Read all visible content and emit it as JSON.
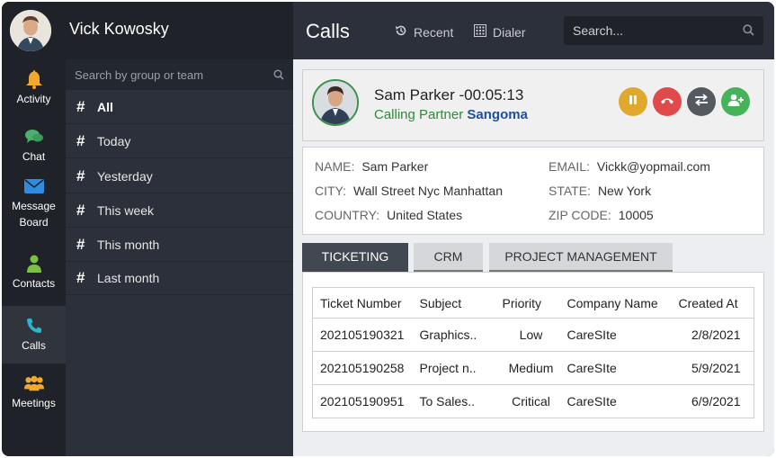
{
  "user": {
    "name": "Vick Kowosky"
  },
  "rail": [
    {
      "label": "Activity",
      "icon": "bell-icon",
      "color": "#f0a92a"
    },
    {
      "label": "Chat",
      "icon": "chat-icon",
      "color": "#4caf6d"
    },
    {
      "label": "Message Board",
      "icon": "envelope-icon",
      "color": "#2e8de0"
    },
    {
      "label": "Contacts",
      "icon": "person-icon",
      "color": "#7ac043"
    },
    {
      "label": "Calls",
      "icon": "phone-icon",
      "color": "#2bb5d1"
    },
    {
      "label": "Meetings",
      "icon": "group-icon",
      "color": "#f0a92a"
    }
  ],
  "groups": {
    "search_placeholder": "Search by group or team",
    "items": [
      "All",
      "Today",
      "Yesterday",
      "This week",
      "This month",
      "Last month"
    ]
  },
  "topbar": {
    "title": "Calls",
    "recent_label": "Recent",
    "dialer_label": "Dialer",
    "search_placeholder": "Search..."
  },
  "call": {
    "name": "Sam Parker",
    "timer": "-00:05:13",
    "calling_label": "Calling Partner",
    "partner": "Sangoma",
    "buttons": [
      {
        "name": "pause-icon",
        "color": "#e0a92e"
      },
      {
        "name": "hangup-icon",
        "color": "#e04a4a"
      },
      {
        "name": "transfer-icon",
        "color": "#555a60"
      },
      {
        "name": "add-user-icon",
        "color": "#45b35a"
      }
    ]
  },
  "contact": {
    "name_label": "NAME:",
    "name": "Sam Parker",
    "email_label": "EMAIL:",
    "email": "Vickk@yopmail.com",
    "city_label": "CITY:",
    "city": "Wall Street Nyc Manhattan",
    "state_label": "STATE:",
    "state": "New York",
    "country_label": "COUNTRY:",
    "country": "United States",
    "zip_label": "ZIP CODE:",
    "zip": "10005"
  },
  "tabs": [
    "TICKETING",
    "CRM",
    "PROJECT MANAGEMENT"
  ],
  "tickets": {
    "headers": [
      "Ticket Number",
      "Subject",
      "Priority",
      "Company Name",
      "Created At"
    ],
    "rows": [
      {
        "number": "202105190321",
        "subject": "Graphics..",
        "priority": "Low",
        "company": "CareSIte",
        "created": "2/8/2021"
      },
      {
        "number": "202105190258",
        "subject": "Project n..",
        "priority": "Medium",
        "company": "CareSIte",
        "created": "5/9/2021"
      },
      {
        "number": "202105190951",
        "subject": "To Sales..",
        "priority": "Critical",
        "company": "CareSIte",
        "created": "6/9/2021"
      }
    ]
  }
}
